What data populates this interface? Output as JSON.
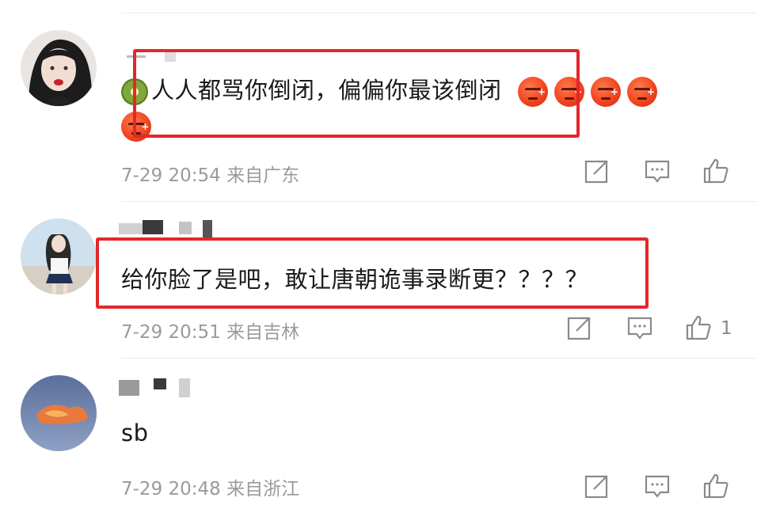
{
  "comments": [
    {
      "text": "人人都骂你倒闭，偏偏你最该倒闭",
      "meta": "7-29 20:54 来自广东",
      "like_count": "",
      "emojis_lead": [
        "kiwi"
      ],
      "emojis_trail": [
        "angry",
        "angry",
        "angry",
        "angry",
        "angry"
      ]
    },
    {
      "text": "给你脸了是吧，敢让唐朝诡事录断更？？？？",
      "meta": "7-29 20:51 来自吉林",
      "like_count": "1"
    },
    {
      "text": "sb",
      "meta": "7-29 20:48 来自浙江",
      "like_count": ""
    }
  ],
  "icons": {
    "repost": "repost-icon",
    "comment": "comment-icon",
    "like": "thumbs-up-icon"
  },
  "colors": {
    "highlight": "#e3272b",
    "meta": "#9a9a9a",
    "text": "#1a1a1a"
  }
}
